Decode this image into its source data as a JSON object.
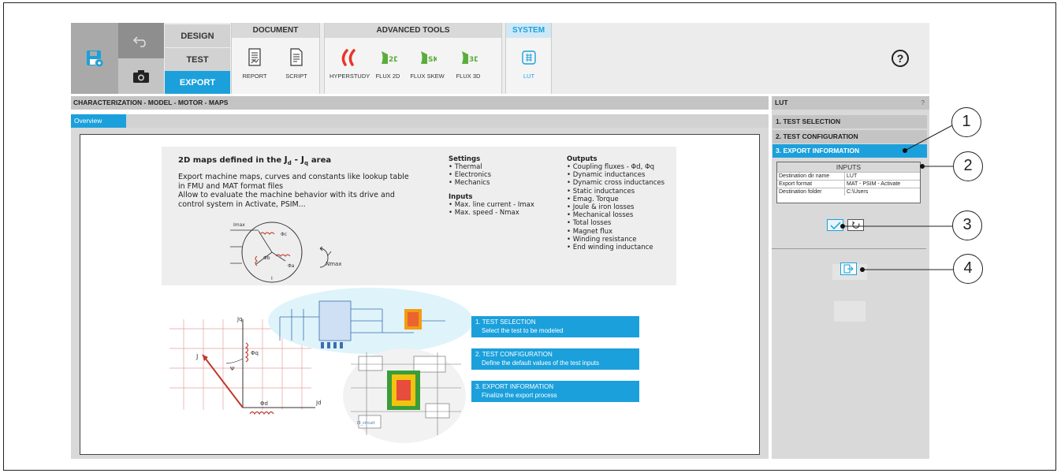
{
  "ribbon": {
    "modes": [
      "DESIGN",
      "TEST",
      "EXPORT"
    ],
    "document": {
      "title": "DOCUMENT",
      "tools": [
        "REPORT",
        "SCRIPT"
      ]
    },
    "advanced": {
      "title": "ADVANCED TOOLS",
      "tools": [
        "HYPERSTUDY",
        "FLUX 2D",
        "FLUX SKEW",
        "FLUX 3D"
      ]
    },
    "system": {
      "title": "SYSTEM",
      "tools": [
        "LUT"
      ]
    },
    "help": "?"
  },
  "main": {
    "breadcrumb": "CHARACTERIZATION - MODEL - MOTOR - MAPS",
    "tab": "Overview",
    "title_prefix": "2D maps defined in the",
    "title_suffix": "area",
    "desc": [
      "Export machine maps, curves and constants like lookup table",
      "in FMU and MAT format files",
      "Allow to evaluate the machine behavior with its drive and",
      "control system in Activate, PSIM..."
    ],
    "settings": {
      "title": "Settings",
      "items": [
        "Thermal",
        "Electronics",
        "Mechanics"
      ]
    },
    "inputs": {
      "title": "Inputs",
      "items": [
        "Max. line current - Imax",
        "Max. speed - Nmax"
      ]
    },
    "outputs": {
      "title": "Outputs",
      "items": [
        "Coupling fluxes - Φd, Φq",
        "Dynamic inductances",
        "Dynamic cross inductances",
        "Static inductances",
        "Emag. Torque",
        "Joule & iron losses",
        "Mechanical losses",
        "Total losses",
        "Magnet flux",
        "Winding resistance",
        "End winding inductance"
      ]
    },
    "diagram": {
      "imax": "Imax",
      "nmax": "Nmax",
      "phi_c": "Φc",
      "phi_a": "Φa",
      "phi_b": "Φb",
      "i": "I",
      "jq": "Jq",
      "jd": "Jd",
      "psi": "Ψ",
      "phi_q": "Φq",
      "phi_d": "Φd",
      "j": "J",
      "circuit": "I3_circuit"
    },
    "steps": [
      {
        "title": "1. TEST SELECTION",
        "desc": "Select the test to be modeled"
      },
      {
        "title": "2. TEST CONFIGURATION",
        "desc": "Define the default values of the test inputs"
      },
      {
        "title": "3. EXPORT INFORMATION",
        "desc": "Finalize the export process"
      }
    ]
  },
  "right": {
    "title": "LUT",
    "help": "?",
    "steps": [
      "1. TEST SELECTION",
      "2. TEST CONFIGURATION",
      "3. EXPORT INFORMATION"
    ],
    "inputs_title": "INPUTS",
    "rows": [
      {
        "k": "Destination dir name",
        "v": "LUT"
      },
      {
        "k": "Export format",
        "v": "MAT - PSIM - Activate"
      },
      {
        "k": "Destination folder",
        "v": "C:\\Users"
      }
    ]
  },
  "callouts": [
    "1",
    "2",
    "3",
    "4"
  ],
  "colors": {
    "accent": "#1ba0dc",
    "panel": "#d9d9d9"
  }
}
